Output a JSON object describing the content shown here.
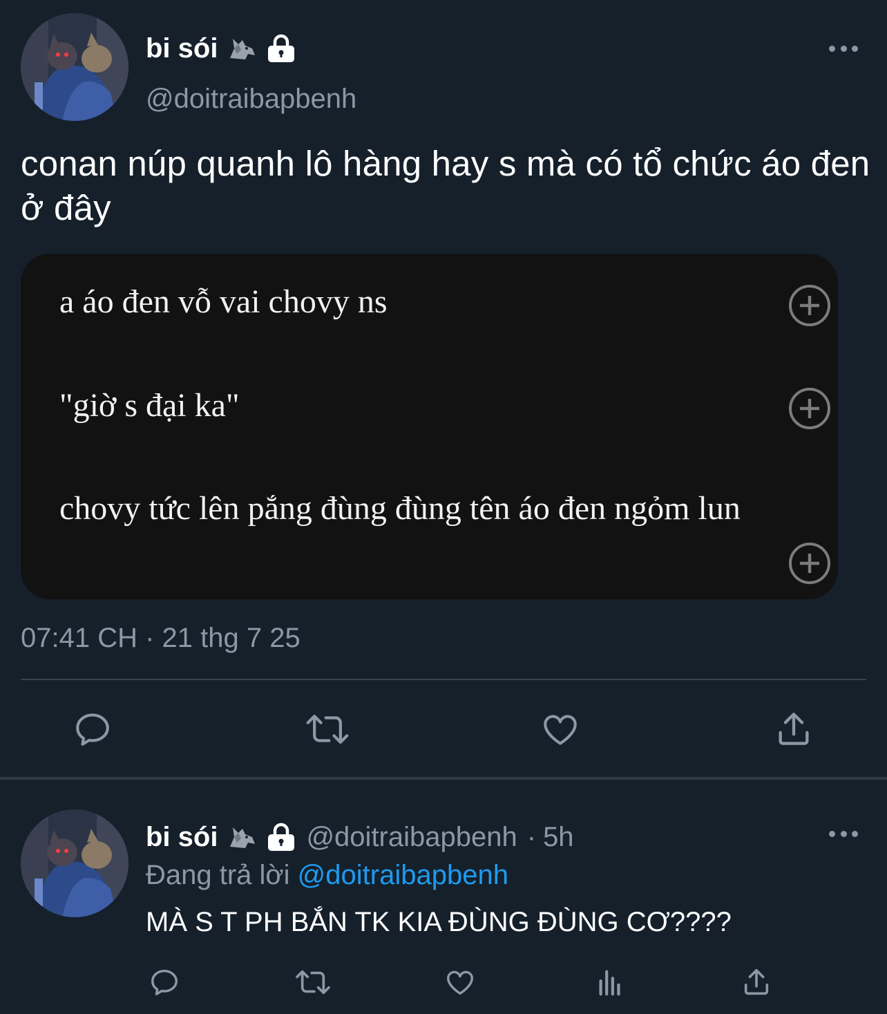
{
  "tweet": {
    "author_name": "bi sói",
    "author_handle": "@doitraibapbenh",
    "text": "conan núp quanh lô hàng hay s mà có tổ chức áo đen ở đây",
    "note_lines": [
      "a áo đen vỗ vai chovy ns",
      "\"giờ s đại ka\"",
      "chovy tức lên pắng đùng đùng tên áo đen ngỏm lun"
    ],
    "timestamp": "07:41 CH · 21 thg 7 25",
    "actions": [
      "reply-icon",
      "retweet-icon",
      "like-icon",
      "share-icon"
    ]
  },
  "reply": {
    "author_name": "bi sói",
    "author_handle": "@doitraibapbenh",
    "separator": "·",
    "time": "5h",
    "replying_prefix": "Đang trả lời",
    "replying_to": "@doitraibapbenh",
    "text": "MÀ S T PH BẮN TK KIA ĐÙNG ĐÙNG CƠ????",
    "actions": [
      "reply-icon",
      "retweet-icon",
      "like-icon",
      "analytics-icon",
      "share-icon"
    ]
  },
  "colors": {
    "background": "#15202b",
    "card": "#121212",
    "secondary_text": "#8b98a5",
    "accent": "#1d9bf0",
    "divider": "#38444d"
  }
}
